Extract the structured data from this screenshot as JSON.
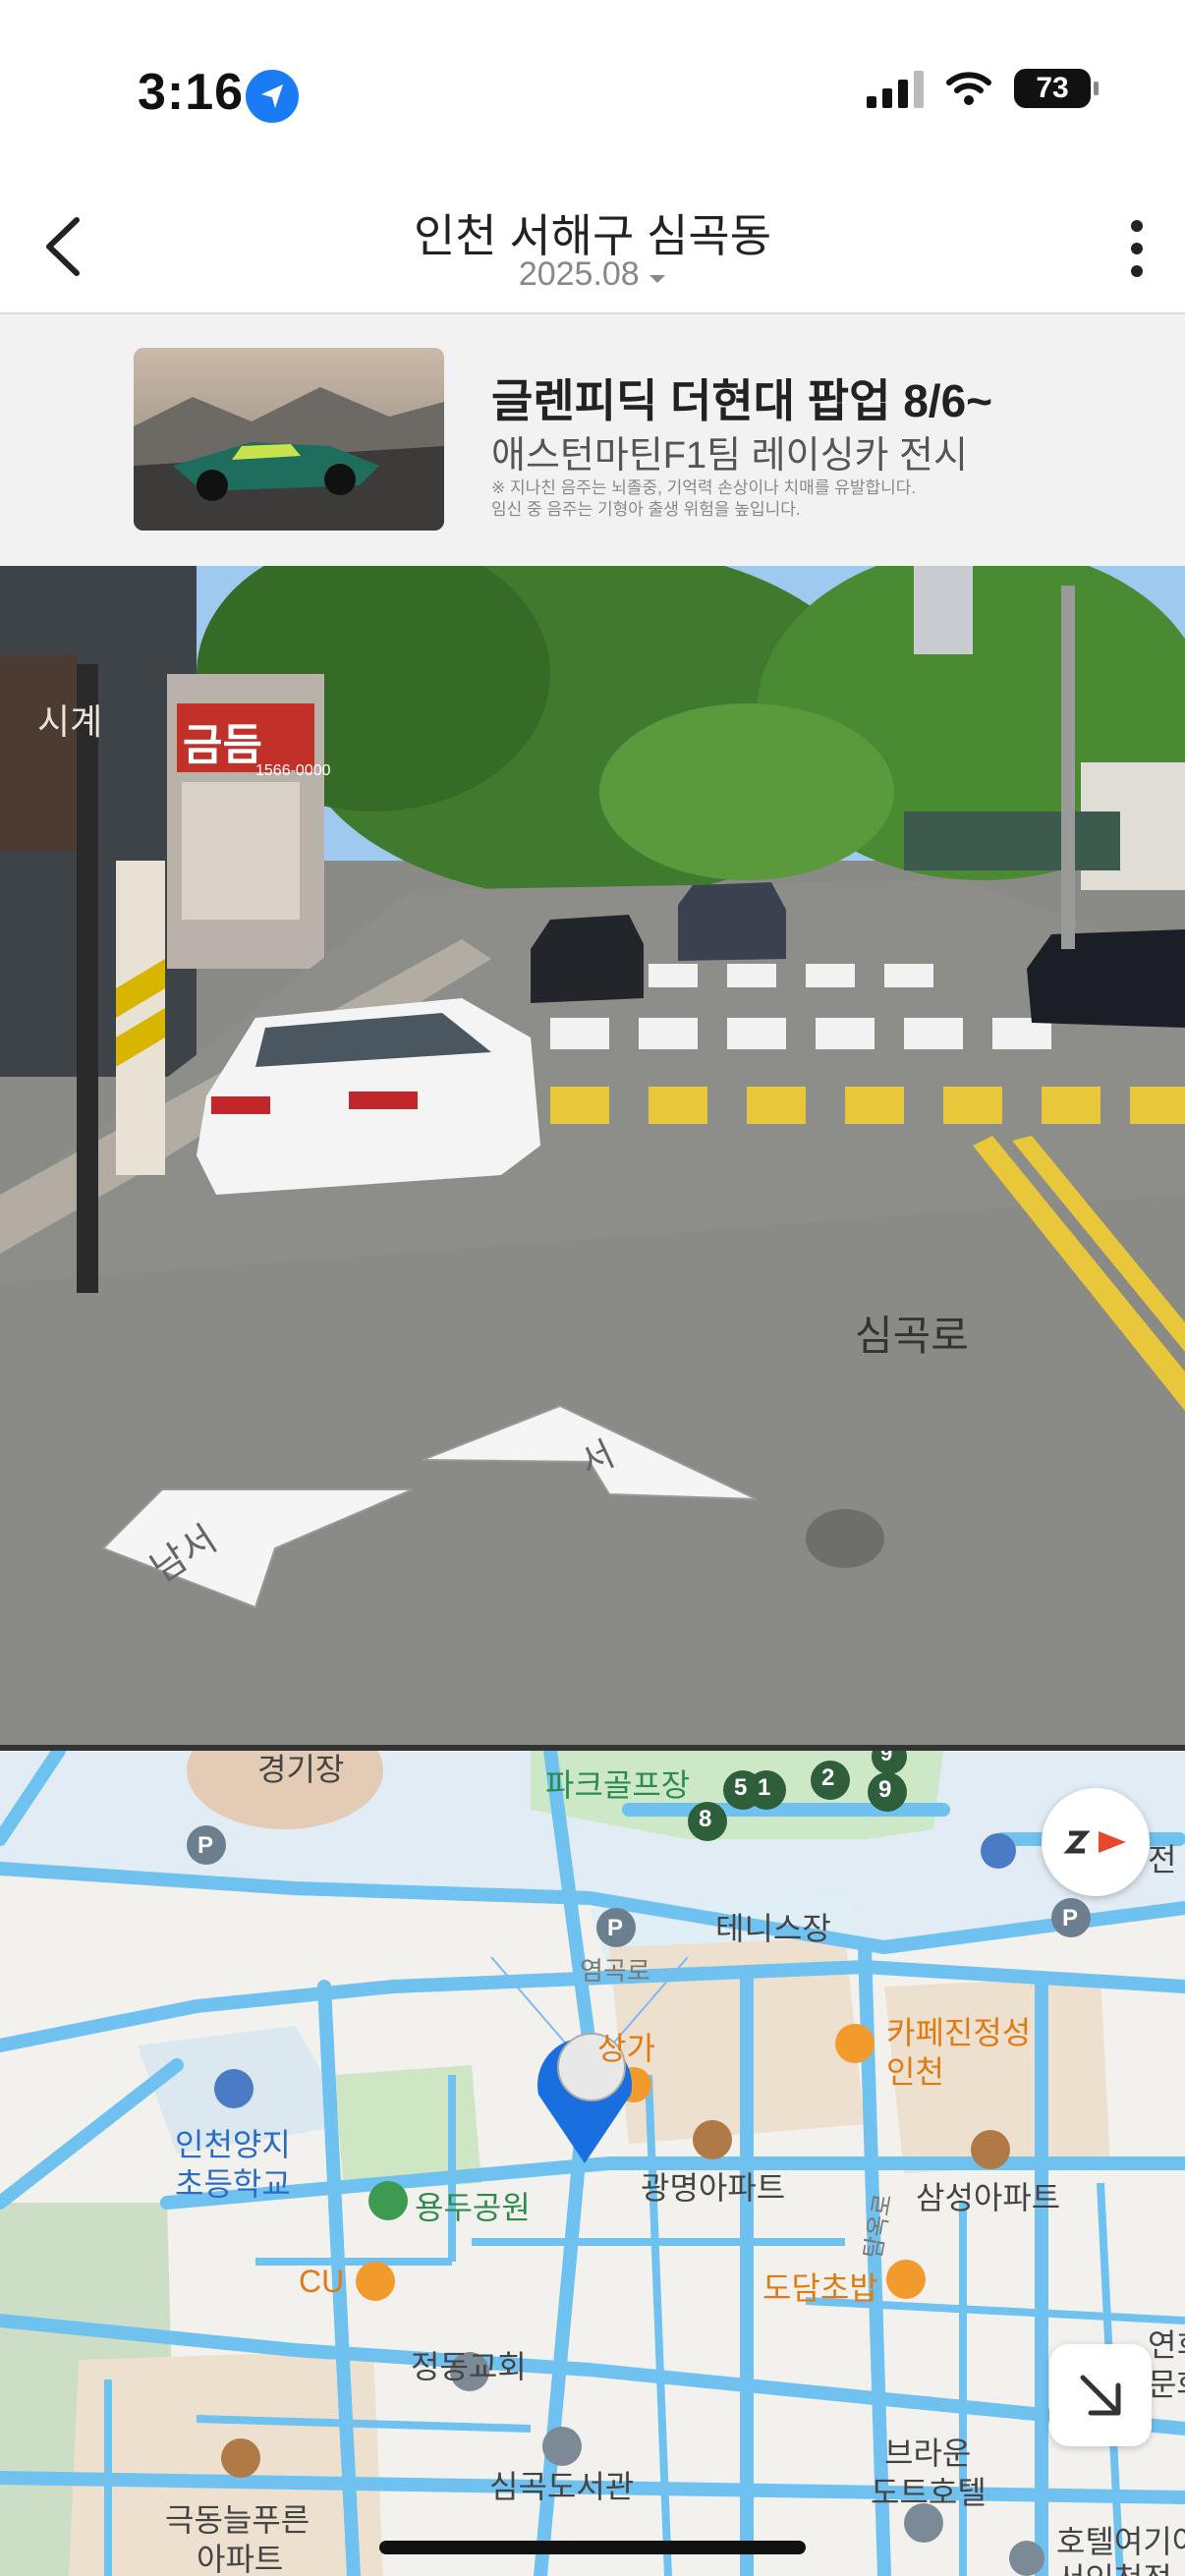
{
  "status_bar": {
    "time": "3:16",
    "battery": "73"
  },
  "header": {
    "title": "인천 서해구 심곡동",
    "date": "2025.08"
  },
  "ad": {
    "title": "글렌피딕 더현대 팝업 8/6~",
    "subtitle": "애스턴마틴F1팀 레이싱카 전시",
    "fine_print_1": "※ 지나친 음주는 뇌졸중, 기억력 손상이나 치매를 유발합니다.",
    "fine_print_2": "임신 중 음주는 기형아 출생 위험을 높입니다."
  },
  "street_view": {
    "road_label": "심곡로",
    "arrow_left_label": "남서",
    "arrow_right_label": "서",
    "store_sign_1": "시계",
    "store_sign_2": "금듬",
    "store_sign_phone": "1566-0000"
  },
  "map": {
    "labels": {
      "stadium": "경기장",
      "golf": "파크골프장",
      "tennis": "테니스장",
      "yeomgok": "염곡로",
      "mall": "상가",
      "cafe_1": "카페진정성",
      "cafe_2": "인천",
      "school_1": "인천양지",
      "school_2": "초등학교",
      "park": "용두공원",
      "gwangmyeong": "광명아파트",
      "samseong": "삼성아파트",
      "cu": "CU",
      "dodam": "도담초밥",
      "church": "정동교회",
      "library": "심곡도서관",
      "hotel_1a": "브라운",
      "hotel_1b": "도트호텔",
      "hotel_2a": "호텔여기어",
      "hotel_2b": "서인천점",
      "geukdong_1": "극동늘푸른",
      "geukdong_2": "아파트",
      "right_edge_1": "연희",
      "right_edge_2": "문화",
      "charging": "전",
      "road_v": "탐옥로"
    },
    "golf_holes": [
      "8",
      "5",
      "1",
      "2",
      "9",
      "9"
    ]
  },
  "colors": {
    "road": "#6fc1f0",
    "accent": "#1a7cf5",
    "park": "#cde8c6",
    "orange": "#f39a2c"
  }
}
